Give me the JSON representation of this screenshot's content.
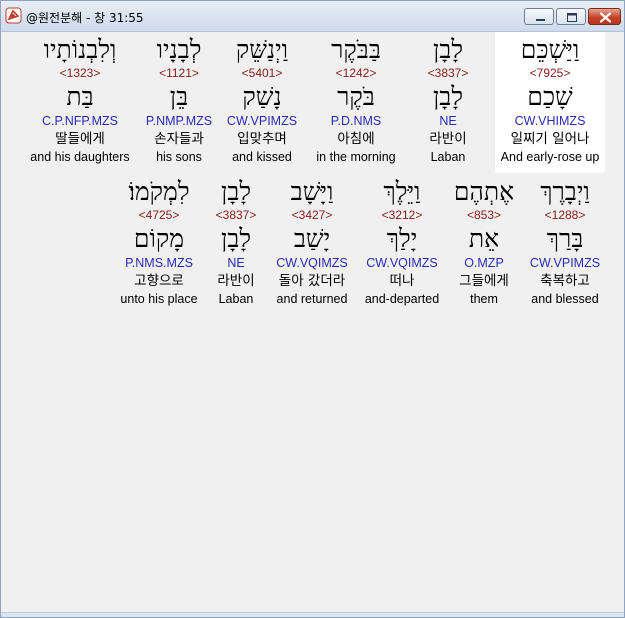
{
  "window": {
    "title": "@원전분해 - 창 31:55"
  },
  "row1": [
    {
      "hebrew": "וַיַּשְׁכֵּם",
      "strong": "<7925>",
      "root": "שָׁכַם",
      "parse": "CW.VHIMZS",
      "korean": "일찌기 일어나",
      "english": "And early-rose up",
      "selected": true
    },
    {
      "hebrew": "לָבָן",
      "strong": "<3837>",
      "root": "לָבָן",
      "parse": "NE",
      "korean": "라반이",
      "english": "Laban",
      "selected": false
    },
    {
      "hebrew": "בַּבֹּקֶר",
      "strong": "<1242>",
      "root": "בֹּקֶר",
      "parse": "P.D.NMS",
      "korean": "아침에",
      "english": "in the morning",
      "selected": false
    },
    {
      "hebrew": "וַיְנַשֵּׁק",
      "strong": "<5401>",
      "root": "נָשַׁק",
      "parse": "CW.VPIMZS",
      "korean": "입맞추며",
      "english": "and kissed",
      "selected": false
    },
    {
      "hebrew": "לְבָנָיו",
      "strong": "<1121>",
      "root": "בֵּן",
      "parse": "P.NMP.MZS",
      "korean": "손자들과",
      "english": "his sons",
      "selected": false
    },
    {
      "hebrew": "וְלִבְנוֹתָיו",
      "strong": "<1323>",
      "root": "בַּת",
      "parse": "C.P.NFP.MZS",
      "korean": "딸들에게",
      "english": "and his daughters",
      "selected": false
    }
  ],
  "row2": [
    {
      "hebrew": "וַיְבָרֶךְ",
      "strong": "<1288>",
      "root": "בָּרַךְ",
      "parse": "CW.VPIMZS",
      "korean": "축복하고",
      "english": "and blessed"
    },
    {
      "hebrew": "אֶתְהֶם",
      "strong": "<853>",
      "root": "אֵת",
      "parse": "O.MZP",
      "korean": "그들에게",
      "english": "them"
    },
    {
      "hebrew": "וַיֵּלֶךְ",
      "strong": "<3212>",
      "root": "יָלַךְ",
      "parse": "CW.VQIMZS",
      "korean": "떠나",
      "english": "and-departed"
    },
    {
      "hebrew": "וַיָּשָׁב",
      "strong": "<3427>",
      "root": "יָשַׁב",
      "parse": "CW.VQIMZS",
      "korean": "돌아 갔더라",
      "english": "and returned"
    },
    {
      "hebrew": "לָבָן",
      "strong": "<3837>",
      "root": "לָבָן",
      "parse": "NE",
      "korean": "라반이",
      "english": "Laban"
    },
    {
      "hebrew": "לִמְקֹמוֹ׃",
      "strong": "<4725>",
      "root": "מָקוֹם",
      "parse": "P.NMS.MZS",
      "korean": "고향으로",
      "english": "unto his place"
    }
  ]
}
